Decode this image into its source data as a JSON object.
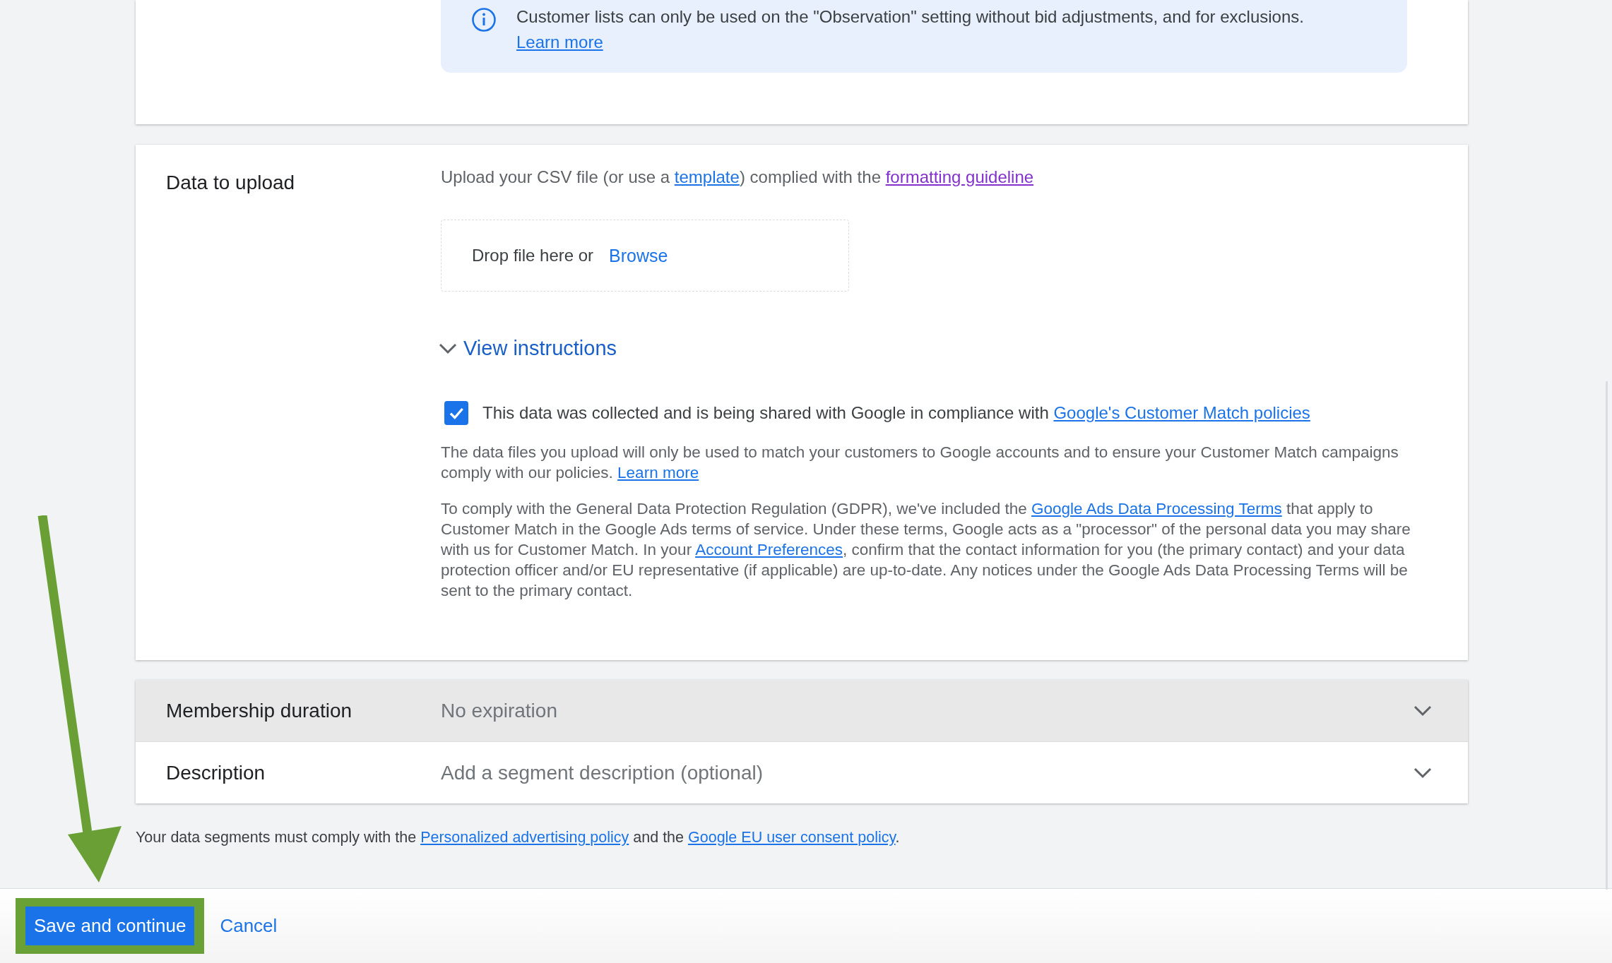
{
  "info_banner": {
    "text": "Customer lists can only be used on the \"Observation\" setting without bid adjustments, and for exclusions.",
    "link": "Learn more"
  },
  "data_to_upload": {
    "label": "Data to upload",
    "instruction": [
      {
        "text": "Upload your CSV file (or use a "
      },
      {
        "link": "template",
        "visited": false
      },
      {
        "text": ") complied with the "
      },
      {
        "link": "formatting guideline",
        "visited": true
      }
    ],
    "drop_zone": {
      "text": "Drop file here or",
      "browse": "Browse"
    },
    "view_instructions": {
      "label": "View instructions",
      "expanded": false
    },
    "consent": {
      "checked": true,
      "text": [
        {
          "text": "This data was collected and is being shared with Google in compliance with "
        },
        {
          "link": "Google's Customer Match policies",
          "visited": false
        }
      ]
    },
    "paragraphs": [
      [
        {
          "text": "The data files you upload will only be used to match your customers to Google accounts and to ensure your Customer Match campaigns comply with our policies. "
        },
        {
          "link": "Learn more",
          "visited": false
        }
      ],
      [
        {
          "text": "To comply with the General Data Protection Regulation (GDPR), we've included the "
        },
        {
          "link": "Google Ads Data Processing Terms",
          "visited": false
        },
        {
          "text": " that apply to Customer Match in the Google Ads terms of service. Under these terms, Google acts as a \"processor\" of the personal data you may share with us for Customer Match. In your "
        },
        {
          "link": "Account Preferences",
          "visited": false
        },
        {
          "text": ", confirm that the contact information for you (the primary contact) and your data protection officer and/or EU representative (if applicable) are up-to-date. Any notices under the Google Ads Data Processing Terms will be sent to the primary contact."
        }
      ]
    ]
  },
  "settings_rows": [
    {
      "label": "Membership duration",
      "value": "No expiration",
      "highlighted": true
    },
    {
      "label": "Description",
      "value": "Add a segment description (optional)",
      "highlighted": false
    }
  ],
  "footer_note": [
    {
      "text": "Your data segments must comply with the "
    },
    {
      "link": "Personalized advertising policy",
      "visited": false
    },
    {
      "text": " and the "
    },
    {
      "link": "Google EU user consent policy",
      "visited": false
    },
    {
      "text": "."
    }
  ],
  "actions": {
    "primary": "Save and continue",
    "cancel": "Cancel"
  }
}
